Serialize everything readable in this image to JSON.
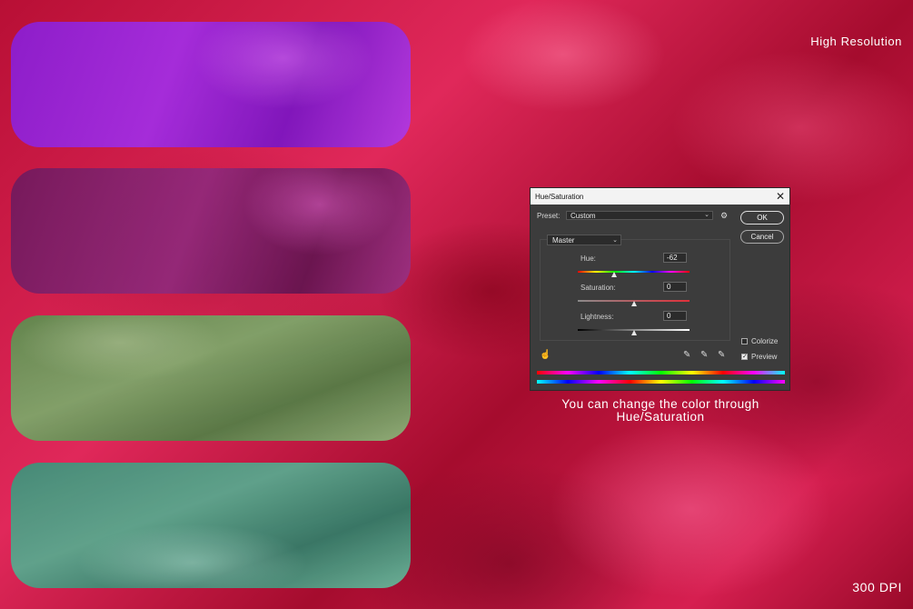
{
  "labels": {
    "high_resolution": "High Resolution",
    "dpi": "300 DPI",
    "caption_line1": "You can change the color through",
    "caption_line2": "Hue/Saturation"
  },
  "dialog": {
    "title": "Hue/Saturation",
    "preset_label": "Preset:",
    "preset_value": "Custom",
    "ok_label": "OK",
    "cancel_label": "Cancel",
    "channel_value": "Master",
    "hue_label": "Hue:",
    "hue_value": "-62",
    "hue_level": -62,
    "saturation_label": "Saturation:",
    "saturation_value": "0",
    "saturation_level": 0,
    "lightness_label": "Lightness:",
    "lightness_value": "0",
    "lightness_level": 0,
    "colorize_label": "Colorize",
    "colorize_checked": false,
    "preview_label": "Preview",
    "preview_checked": true
  },
  "icons": {
    "close": "close-icon",
    "gear": "gear-icon",
    "hand": "on-image-adjust-icon",
    "eyedropper": "eyedropper-icon",
    "eyedropper_add": "eyedropper-plus-icon",
    "eyedropper_sub": "eyedropper-minus-icon"
  },
  "colors": {
    "swatches": [
      "#8a1fd6",
      "#8e2a7e",
      "#7ea66a",
      "#5aa88e"
    ],
    "background": "#c4143a"
  }
}
